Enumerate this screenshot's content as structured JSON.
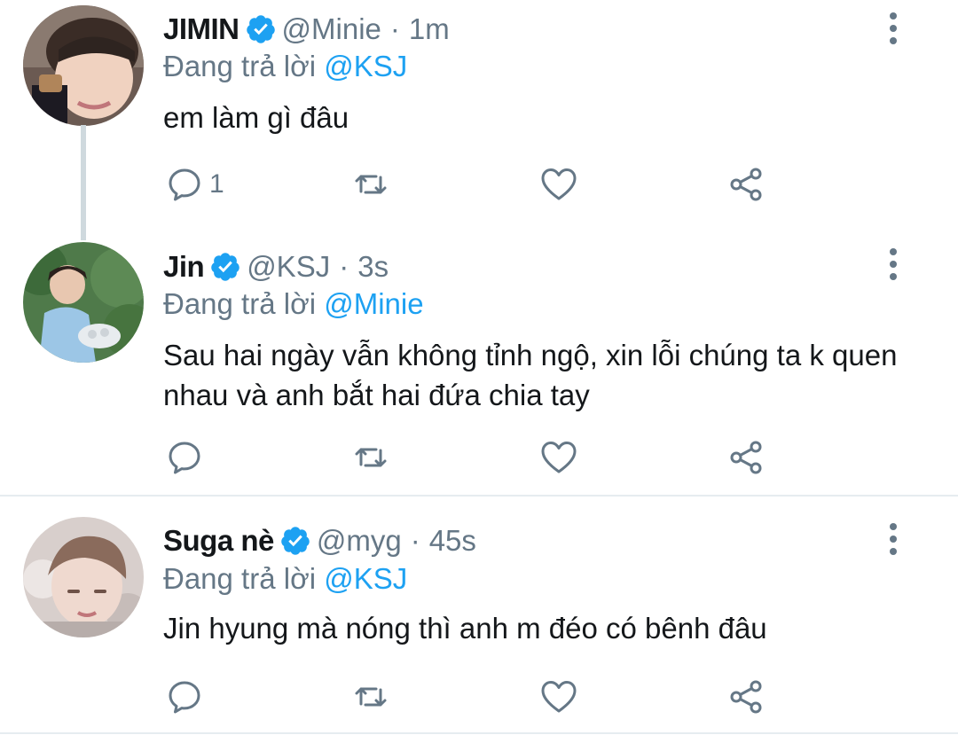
{
  "tweets": [
    {
      "name": "JIMIN",
      "handle": "@Minie",
      "separator": "·",
      "time": "1m",
      "reply_prefix": "Đang trả lời",
      "reply_to": "@KSJ",
      "text": "em làm gì đâu",
      "reply_count": "1",
      "avatar_icon": "avatar-jimin"
    },
    {
      "name": "Jin",
      "handle": "@KSJ",
      "separator": "·",
      "time": "3s",
      "reply_prefix": "Đang trả lời",
      "reply_to": "@Minie",
      "text": "Sau hai ngày vẫn không tỉnh ngộ, xin lỗi chúng ta k quen nhau và anh bắt hai đứa chia tay",
      "reply_count": "",
      "avatar_icon": "avatar-jin"
    },
    {
      "name": "Suga nè",
      "handle": "@myg",
      "separator": "·",
      "time": "45s",
      "reply_prefix": "Đang trả lời",
      "reply_to": "@KSJ",
      "text": "Jin hyung mà nóng thì anh m đéo có bênh đâu",
      "reply_count": "",
      "avatar_icon": "avatar-suga"
    }
  ],
  "colors": {
    "link": "#1da1f2",
    "secondary_text": "#657786",
    "primary_text": "#14171a",
    "verified": "#1da1f2",
    "divider": "#e6ecf0"
  },
  "icons": [
    "verified-badge-icon",
    "more-vertical-icon",
    "reply-icon",
    "retweet-icon",
    "like-heart-icon",
    "share-icon"
  ]
}
